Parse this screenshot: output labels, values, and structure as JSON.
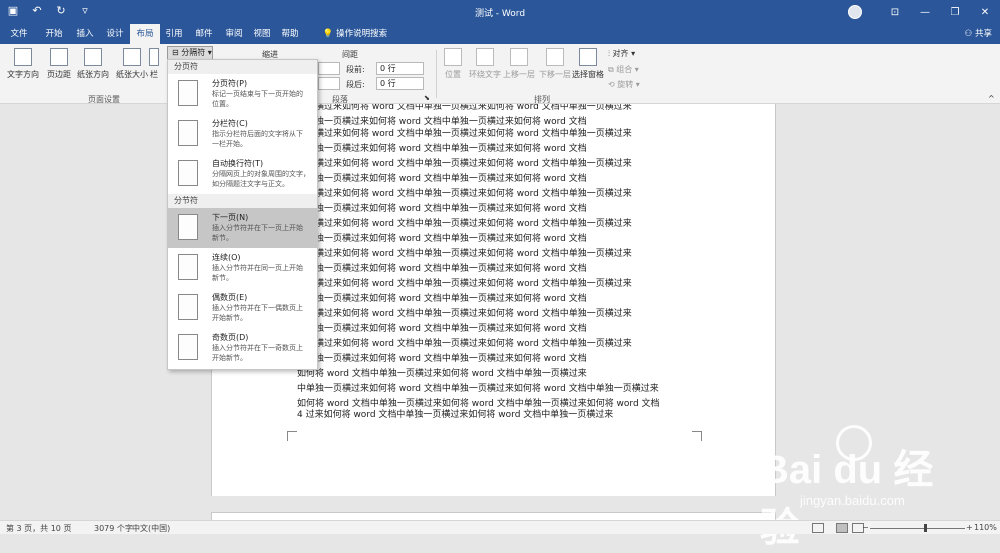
{
  "window": {
    "title": "测试 - Word"
  },
  "menu": {
    "tabs": [
      "文件",
      "开始",
      "插入",
      "设计",
      "布局",
      "引用",
      "邮件",
      "审阅",
      "视图",
      "帮助"
    ],
    "active": "布局",
    "tell_me": "操作说明搜索",
    "share": "共享"
  },
  "ribbon": {
    "page_setup": {
      "buttons": [
        "文字方向",
        "页边距",
        "纸张方向",
        "纸张大小",
        "栏"
      ],
      "label": "页面设置",
      "breaks_button": "分隔符"
    },
    "paragraph": {
      "indent_label": "缩进",
      "spacing_label": "间距",
      "before_label": "段前:",
      "before_value": "0 行",
      "after_label": "段后:",
      "after_value": "0 行",
      "label": "段落"
    },
    "arrange": {
      "buttons": [
        "位置",
        "环绕文字",
        "上移一层",
        "下移一层",
        "选择窗格"
      ],
      "align": "对齐",
      "group": "组合",
      "rotate": "旋转",
      "label": "排列"
    }
  },
  "breaks_menu": {
    "section_page": "分页符",
    "page_items": [
      {
        "title": "分页符(P)",
        "desc": [
          "标记一页结束与下一页开始的",
          "位置。"
        ]
      },
      {
        "title": "分栏符(C)",
        "desc": [
          "指示分栏符后面的文字将从下",
          "一栏开始。"
        ]
      },
      {
        "title": "自动换行符(T)",
        "desc": [
          "分隔网页上的对象周围的文字，",
          "如分隔题注文字与正文。"
        ]
      }
    ],
    "section_section": "分节符",
    "section_items": [
      {
        "title": "下一页(N)",
        "desc": [
          "插入分节符并在下一页上开始",
          "新节。"
        ]
      },
      {
        "title": "连续(O)",
        "desc": [
          "插入分节符并在同一页上开始",
          "新节。"
        ]
      },
      {
        "title": "偶数页(E)",
        "desc": [
          "插入分节符并在下一偶数页上",
          "开始新节。"
        ]
      },
      {
        "title": "奇数页(D)",
        "desc": [
          "插入分节符并在下一奇数页上",
          "开始新节。"
        ]
      }
    ]
  },
  "document": {
    "lines": [
      "一页横过来如何将 word 文档中单独一页横过来如何将 word 文档中单独一页横过来",
      "中单独一页横过来如何将 word 文档中单独一页横过来如何将 word 文档",
      "一页横过来如何将 word 文档中单独一页横过来如何将 word 文档中单独一页横过来",
      "中单独一页横过来如何将 word 文档中单独一页横过来如何将 word 文档",
      "一页横过来如何将 word 文档中单独一页横过来如何将 word 文档中单独一页横过来",
      "中单独一页横过来如何将 word 文档中单独一页横过来如何将 word 文档",
      "一页横过来如何将 word 文档中单独一页横过来如何将 word 文档中单独一页横过来",
      "中单独一页横过来如何将 word 文档中单独一页横过来如何将 word 文档",
      "一页横过来如何将 word 文档中单独一页横过来如何将 word 文档中单独一页横过来",
      "中单独一页横过来如何将 word 文档中单独一页横过来如何将 word 文档",
      "一页横过来如何将 word 文档中单独一页横过来如何将 word 文档中单独一页横过来",
      "中单独一页横过来如何将 word 文档中单独一页横过来如何将 word 文档",
      "一页横过来如何将 word 文档中单独一页横过来如何将 word 文档中单独一页横过来",
      "中单独一页横过来如何将 word 文档中单独一页横过来如何将 word 文档",
      "一页横过来如何将 word 文档中单独一页横过来如何将 word 文档中单独一页横过来",
      "中单独一页横过来如何将 word 文档中单独一页横过来如何将 word 文档",
      "一页横过来如何将 word 文档中单独一页横过来如何将 word 文档中单独一页横过来",
      "中单独一页横过来如何将 word 文档中单独一页横过来如何将 word 文档",
      "如何将 word 文档中单独一页横过来如何将 word 文档中单独一页横过来",
      "中单独一页横过来如何将 word 文档中单独一页横过来如何将 word 文档中单独一页横过来",
      "如何将 word 文档中单独一页横过来如何将 word 文档中单独一页横过来如何将 word 文档",
      "4 过来如何将 word 文档中单独一页横过来如何将 word 文档中单独一页横过来"
    ]
  },
  "status": {
    "page": "第 3 页，共 10 页",
    "words": "3079 个字",
    "language": "中文(中国)",
    "zoom": "110%"
  },
  "watermark": {
    "brand": "Bai du 经验",
    "url": "jingyan.baidu.com"
  },
  "colors": {
    "accent": "#2b579a",
    "selected": "#c6c6c6"
  }
}
